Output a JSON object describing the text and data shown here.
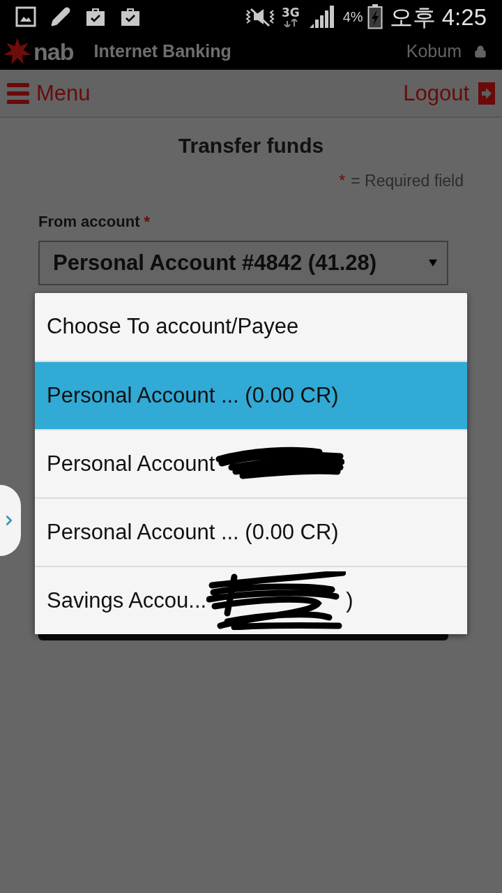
{
  "status_bar": {
    "network": "3G",
    "battery": "4%",
    "time": "오후 4:25"
  },
  "header": {
    "logo": "nab",
    "title": "Internet Banking",
    "user": "Kobum"
  },
  "nav": {
    "menu": "Menu",
    "logout": "Logout"
  },
  "form": {
    "title": "Transfer funds",
    "required_note": {
      "marker": "*",
      "text": "= Required field"
    },
    "from_account": {
      "label": "From account",
      "marker": "*",
      "value": "Personal Account #4842 (41.28)"
    }
  },
  "picker": {
    "title": "Choose To account/Payee",
    "options": [
      {
        "label": "Personal Account ... (0.00 CR)",
        "selected": true,
        "redacted": false
      },
      {
        "label": "Personal Account",
        "selected": false,
        "redacted": true
      },
      {
        "label": "Personal Account ... (0.00 CR)",
        "selected": false,
        "redacted": false
      },
      {
        "label": "Savings Accou...",
        "suffix": ")",
        "selected": false,
        "redacted": true
      }
    ]
  }
}
